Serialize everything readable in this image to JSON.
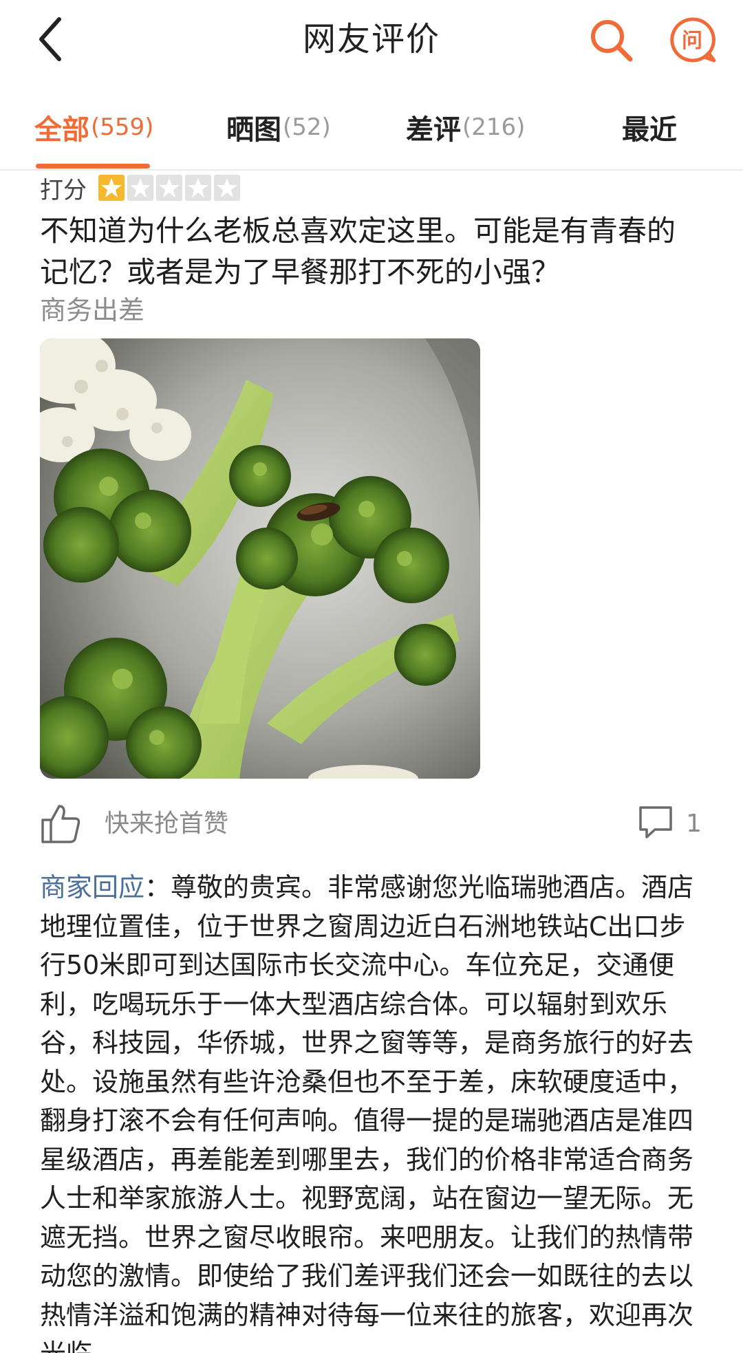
{
  "header": {
    "title": "网友评价",
    "ask_glyph": "问"
  },
  "tabs": [
    {
      "label": "全部",
      "count": "(559)",
      "active": true
    },
    {
      "label": "晒图",
      "count": "(52)",
      "active": false
    },
    {
      "label": "差评",
      "count": "(216)",
      "active": false
    },
    {
      "label": "最近",
      "count": "",
      "active": false
    }
  ],
  "review": {
    "rating_label": "打分",
    "rating": 1,
    "rating_max": 5,
    "text": "不知道为什么老板总喜欢定这里。可能是有青春的记忆？或者是为了早餐那打不死的小强？",
    "trip_type": "商务出差",
    "like_text": "快来抢首赞",
    "comment_count": "1"
  },
  "reply": {
    "label": "商家回应",
    "text": "：尊敬的贵宾。非常感谢您光临瑞驰酒店。酒店地理位置佳，位于世界之窗周边近白石洲地铁站C出口步行50米即可到达国际市长交流中心。车位充足，交通便利，吃喝玩乐于一体大型酒店综合体。可以辐射到欢乐谷，科技园，华侨城，世界之窗等等，是商务旅行的好去处。设施虽然有些许沧桑但也不至于差，床软硬度适中，翻身打滚不会有任何声响。值得一提的是瑞驰酒店是准四星级酒店，再差能差到哪里去，我们的价格非常适合商务人士和举家旅游人士。视野宽阔，站在窗边一望无际。无遮无挡。世界之窗尽收眼帘。来吧朋友。让我们的热情带动您的激情。即使给了我们差评我们还会一如既往的去以热情洋溢和饱满的精神对待每一位来往的旅客，欢迎再次光临"
  },
  "colors": {
    "accent": "#ef6b38",
    "star_filled": "#f5b82e",
    "star_empty": "#e2e2e2",
    "reply_label": "#4b6f9c",
    "muted": "#8c8c8c"
  }
}
